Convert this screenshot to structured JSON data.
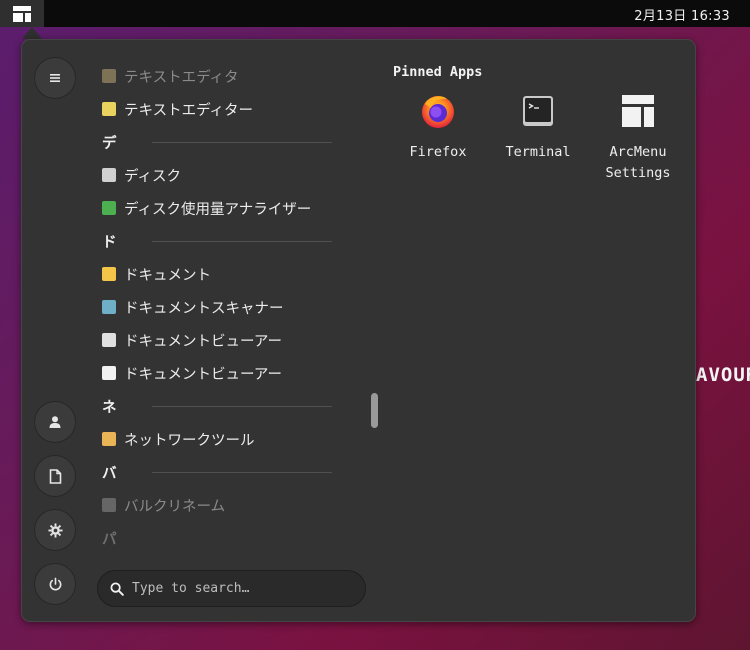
{
  "topbar": {
    "clock": "2月13日  16:33"
  },
  "wallpaper": {
    "text_main": "AVOUR",
    "text_accent": "O"
  },
  "sidebar": {
    "buttons": [
      {
        "name": "menu-icon"
      },
      {
        "name": "user-icon"
      },
      {
        "name": "document-icon"
      },
      {
        "name": "settings-icon"
      },
      {
        "name": "power-icon"
      }
    ]
  },
  "app_list": {
    "rows": [
      {
        "kind": "app",
        "label": "テキストエディタ",
        "icon_color": "#c9b27a",
        "faded": true
      },
      {
        "kind": "app",
        "label": "テキストエディター",
        "icon_color": "#e9d25d",
        "faded": false
      },
      {
        "kind": "section",
        "label": "デ"
      },
      {
        "kind": "app",
        "label": "ディスク",
        "icon_color": "#d0d0d0",
        "faded": false
      },
      {
        "kind": "app",
        "label": "ディスク使用量アナライザー",
        "icon_color": "#4caf50",
        "faded": false
      },
      {
        "kind": "section",
        "label": "ド"
      },
      {
        "kind": "app",
        "label": "ドキュメント",
        "icon_color": "#f3c64a",
        "faded": false
      },
      {
        "kind": "app",
        "label": "ドキュメントスキャナー",
        "icon_color": "#6fb0c8",
        "faded": false
      },
      {
        "kind": "app",
        "label": "ドキュメントビューアー",
        "icon_color": "#e0e0e0",
        "faded": false
      },
      {
        "kind": "app",
        "label": "ドキュメントビューアー",
        "icon_color": "#f2f2f2",
        "faded": false
      },
      {
        "kind": "section",
        "label": "ネ"
      },
      {
        "kind": "app",
        "label": "ネットワークツール",
        "icon_color": "#e9b455",
        "faded": false
      },
      {
        "kind": "section",
        "label": "バ"
      },
      {
        "kind": "app",
        "label": "バルクリネーム",
        "icon_color": "#9a9a9a",
        "faded": true
      },
      {
        "kind": "section",
        "label": "パ",
        "faded": true
      }
    ]
  },
  "search": {
    "placeholder": "Type to search…"
  },
  "pinned": {
    "title": "Pinned Apps",
    "apps": [
      {
        "label": "Firefox",
        "icon": "firefox-icon"
      },
      {
        "label": "Terminal",
        "icon": "terminal-icon"
      },
      {
        "label": "ArcMenu\nSettings",
        "icon": "arcmenu-icon"
      }
    ]
  }
}
